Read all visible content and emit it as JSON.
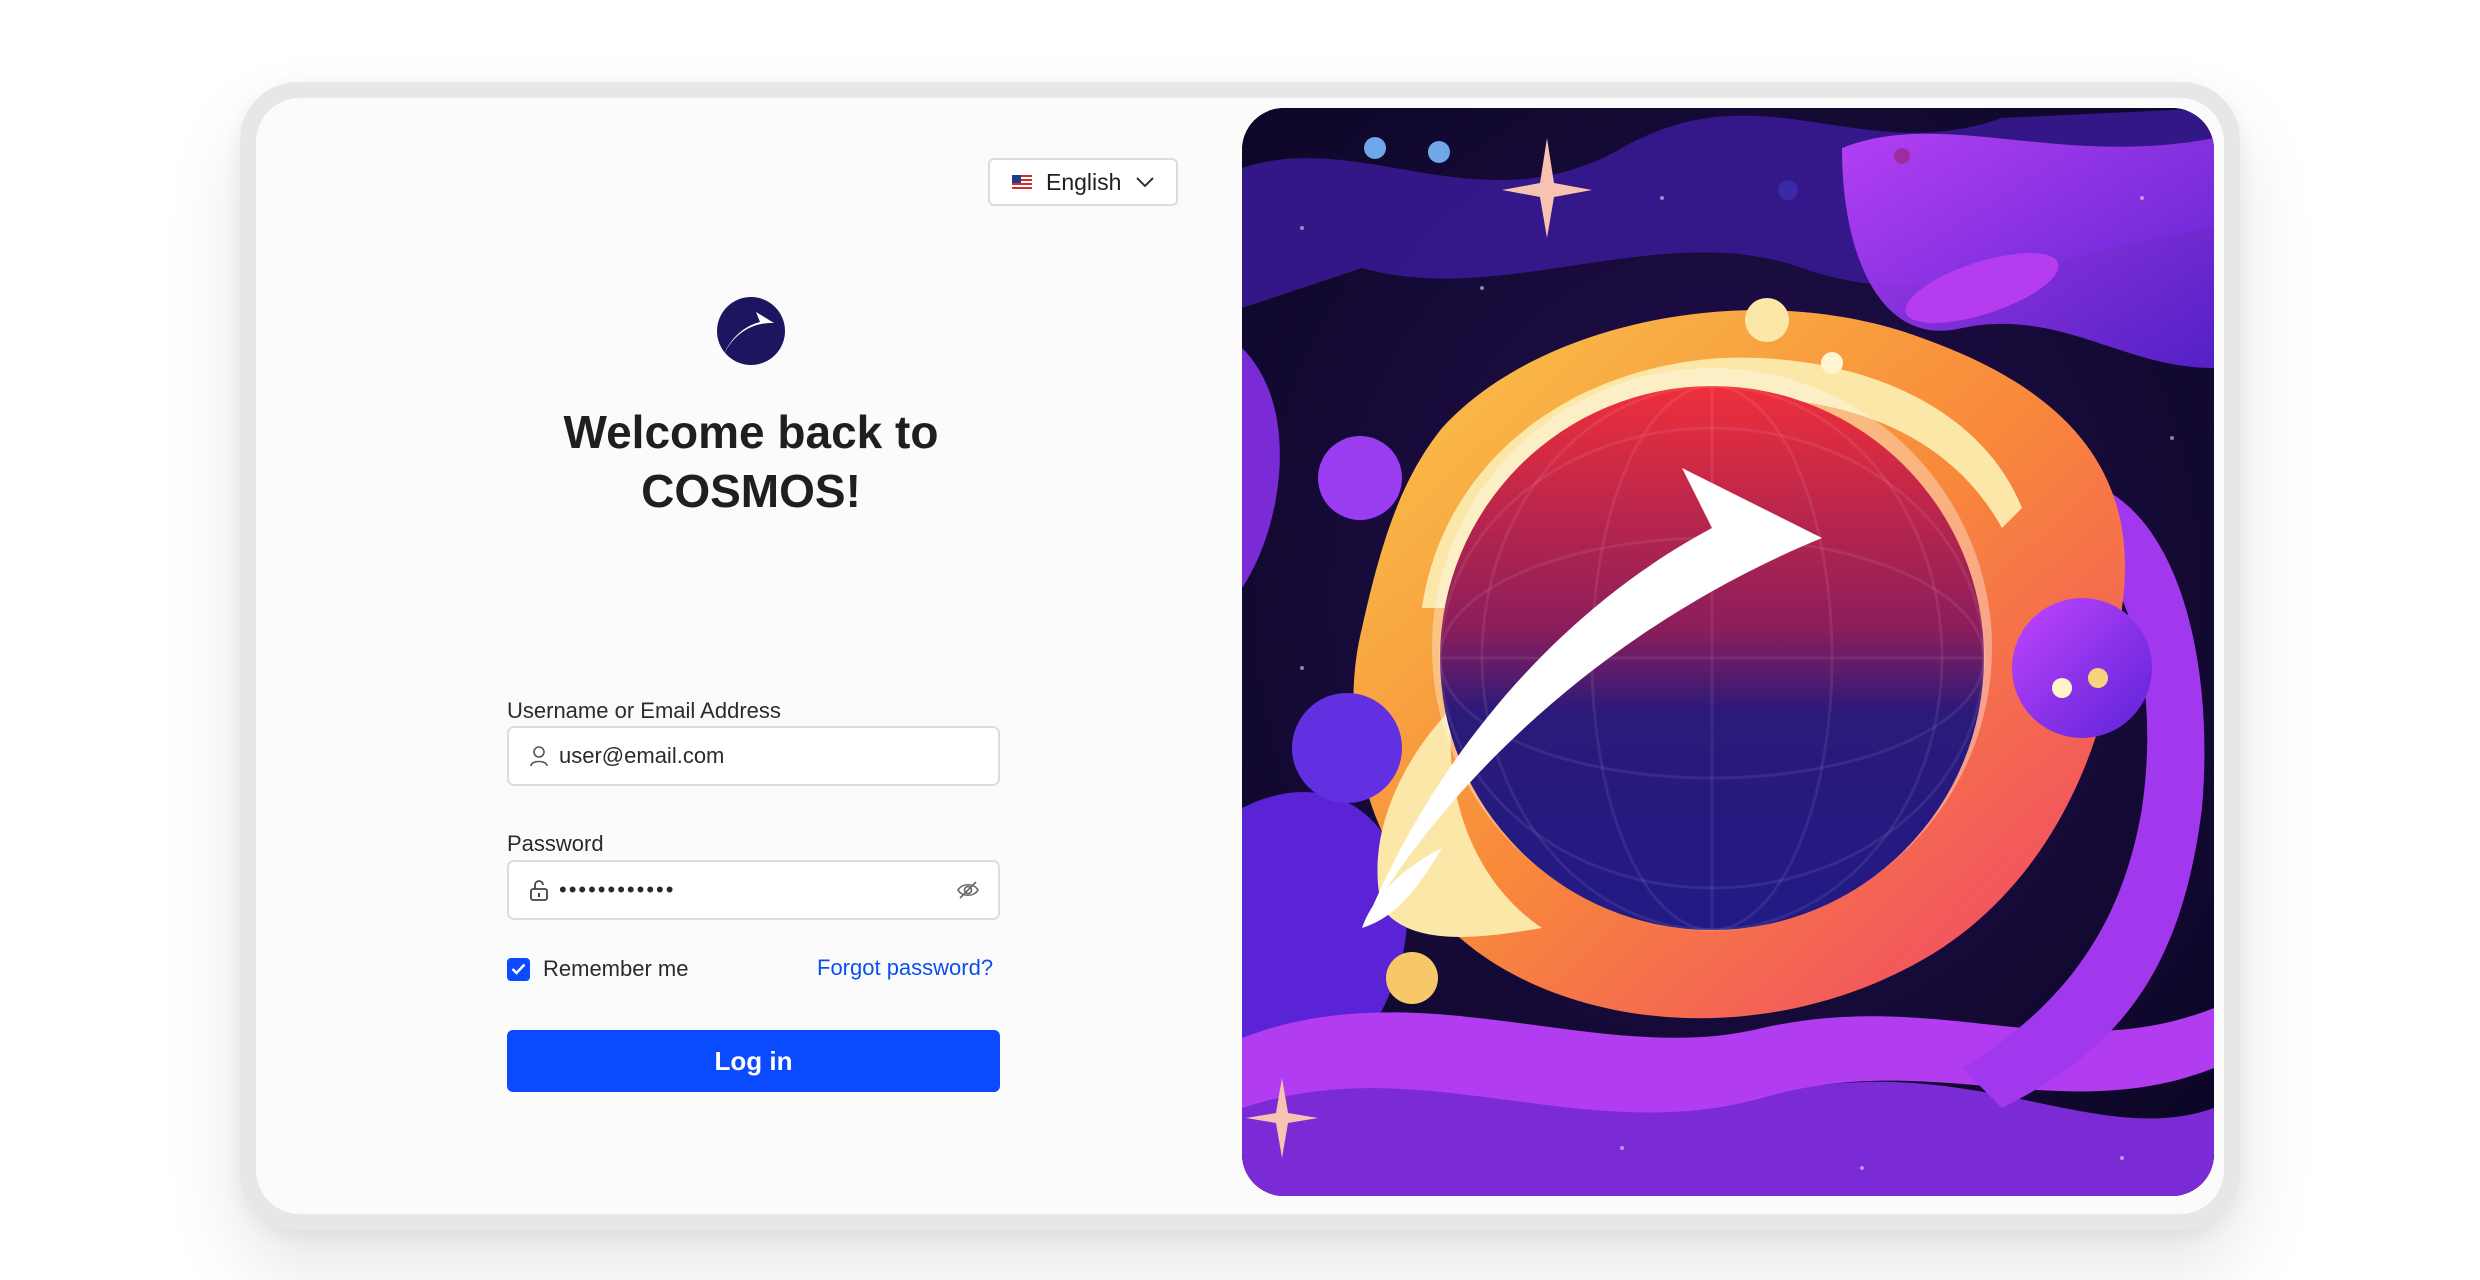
{
  "language": {
    "selected": "English",
    "flag_icon": "us-flag-icon"
  },
  "brand": {
    "logo_icon": "cosmos-arrow-logo-icon",
    "logo_color": "#1c1660"
  },
  "title": {
    "line1": "Welcome back to",
    "line2": "COSMOS!"
  },
  "form": {
    "username": {
      "label": "Username or Email Address",
      "value": "user@email.com",
      "icon": "user-icon"
    },
    "password": {
      "label": "Password",
      "value_masked": "••••••••••••",
      "icon": "unlock-icon",
      "toggle_icon": "eye-off-icon"
    },
    "remember": {
      "label": "Remember me",
      "checked": true
    },
    "forgot_label": "Forgot password?",
    "submit_label": "Log in"
  },
  "colors": {
    "accent": "#0a4bff",
    "link": "#0a50ee",
    "text": "#1f1f1f"
  },
  "illustration": {
    "icon": "space-planet-illustration"
  }
}
